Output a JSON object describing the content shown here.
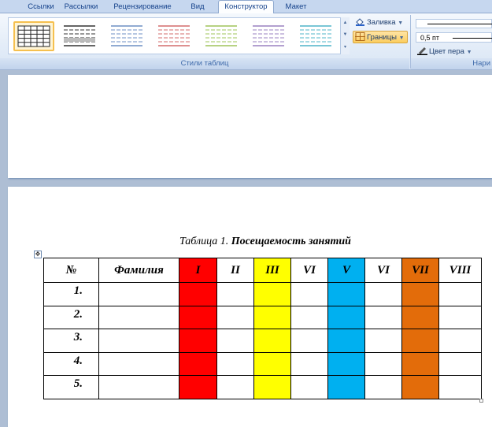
{
  "ribbon": {
    "tabs": [
      {
        "label": "Ссылки",
        "active": false
      },
      {
        "label": "Рассылки",
        "active": false
      },
      {
        "label": "Рецензирование",
        "active": false
      },
      {
        "label": "Вид",
        "active": false
      },
      {
        "label": "Конструктор",
        "active": true
      },
      {
        "label": "Макет",
        "active": false
      }
    ],
    "table_styles_caption": "Стили таблиц",
    "shading_label": "Заливка",
    "borders_label": "Границы",
    "pen_weight": "0,5 пт",
    "pen_color_label": "Цвет пера",
    "draw_borders_caption": "Нари"
  },
  "style_gallery": [
    {
      "line": "#222222",
      "selected": true
    },
    {
      "line": "#333333",
      "selected": false
    },
    {
      "line": "#6d8fc4",
      "selected": false
    },
    {
      "line": "#d36b6b",
      "selected": false
    },
    {
      "line": "#9fc45a",
      "selected": false
    },
    {
      "line": "#9a80c0",
      "selected": false
    },
    {
      "line": "#4fb4c8",
      "selected": false
    }
  ],
  "document": {
    "caption_prefix": "Таблица 1.",
    "caption_title": "Посещаемость занятий",
    "table": {
      "headers": [
        "№",
        "Фамилия",
        "I",
        "II",
        "III",
        "VI",
        "V",
        "VI",
        "VII",
        "VIII"
      ],
      "column_colors": [
        "#ffffff",
        "#ffffff",
        "#ff0000",
        "#ffffff",
        "#ffff00",
        "#ffffff",
        "#00b0f0",
        "#ffffff",
        "#e36c0a",
        "#ffffff"
      ],
      "rows": [
        "1.",
        "2.",
        "3.",
        "4.",
        "5."
      ]
    }
  }
}
